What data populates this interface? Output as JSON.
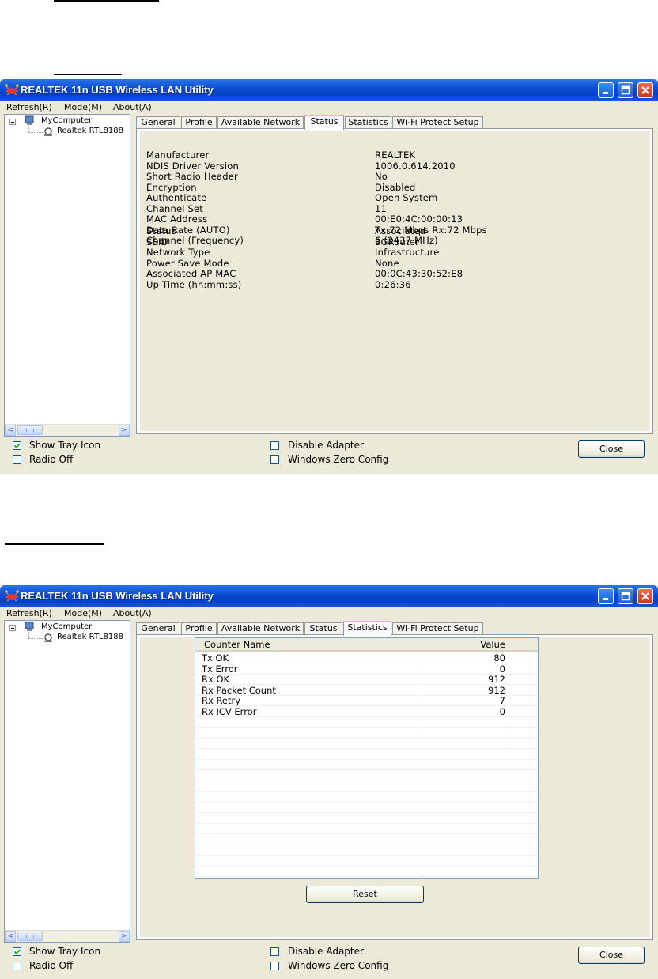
{
  "window": {
    "title": "REALTEK 11n USB Wireless LAN Utility",
    "menu": [
      "Refresh(R)",
      "Mode(M)",
      "About(A)"
    ],
    "tree": {
      "root": "MyComputer",
      "child": "Realtek RTL8188"
    },
    "scroll": {
      "left": "<",
      "thumb": "III",
      "right": ">"
    },
    "tabs": [
      "General",
      "Profile",
      "Available Network",
      "Status",
      "Statistics",
      "Wi-Fi Protect Setup"
    ]
  },
  "status": {
    "group1": [
      {
        "label": "Manufacturer",
        "value": "REALTEK"
      },
      {
        "label": "NDIS Driver Version",
        "value": "1006.0.614.2010"
      },
      {
        "label": "Short Radio Header",
        "value": "No"
      },
      {
        "label": "Encryption",
        "value": "Disabled"
      },
      {
        "label": "Authenticate",
        "value": "Open System"
      },
      {
        "label": "Channel Set",
        "value": "11"
      },
      {
        "label": "MAC Address",
        "value": "00:E0:4C:00:00:13"
      },
      {
        "label": "Data Rate (AUTO)",
        "value": "Tx:72 Mbps Rx:72 Mbps"
      },
      {
        "label": "Channel (Frequency)",
        "value": "6 (2437 MHz)"
      }
    ],
    "group2": [
      {
        "label": "Status",
        "value": "Associated"
      },
      {
        "label": "SSID",
        "value": "3GRouter"
      },
      {
        "label": "Network Type",
        "value": "Infrastructure"
      },
      {
        "label": "Power Save Mode",
        "value": "None"
      },
      {
        "label": "Associated AP MAC",
        "value": "00:0C:43:30:52:E8"
      },
      {
        "label": "Up Time (hh:mm:ss)",
        "value": "0:26:36"
      }
    ]
  },
  "statistics": {
    "columns": [
      "Counter Name",
      "Value"
    ],
    "rows": [
      {
        "name": "Tx OK",
        "value": "80"
      },
      {
        "name": "Tx Error",
        "value": "0"
      },
      {
        "name": "Rx OK",
        "value": "912"
      },
      {
        "name": "Rx Packet Count",
        "value": "912"
      },
      {
        "name": "Rx Retry",
        "value": "7"
      },
      {
        "name": "Rx ICV Error",
        "value": "0"
      }
    ],
    "reset_label": "Reset"
  },
  "footer": {
    "show_tray_icon": "Show Tray Icon",
    "radio_off": "Radio Off",
    "disable_adapter": "Disable Adapter",
    "windows_zero_config": "Windows Zero Config",
    "close": "Close",
    "show_tray_checked": true
  },
  "colors": {
    "titlebar": "#0a4bd1",
    "tab_highlight": "#ffc83c",
    "face": "#ece9d8"
  }
}
